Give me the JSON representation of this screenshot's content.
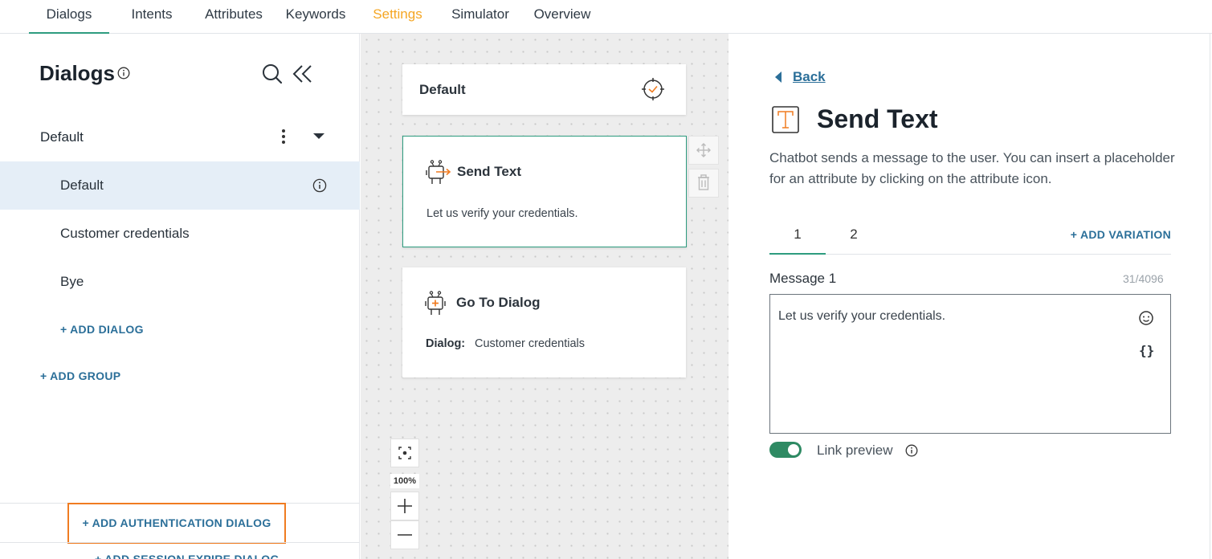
{
  "top_tabs": [
    {
      "label": "Dialogs"
    },
    {
      "label": "Intents"
    },
    {
      "label": "Attributes"
    },
    {
      "label": "Keywords"
    },
    {
      "label": "Settings"
    },
    {
      "label": "Simulator"
    },
    {
      "label": "Overview"
    }
  ],
  "sidebar": {
    "title": "Dialogs",
    "group": {
      "label": "Default"
    },
    "items": [
      {
        "label": "Default"
      },
      {
        "label": "Customer credentials"
      },
      {
        "label": "Bye"
      }
    ],
    "add_dialog": "+ ADD DIALOG",
    "add_group": "+ ADD GROUP",
    "add_auth_dialog": "+ ADD AUTHENTICATION DIALOG",
    "add_session_dialog": "+ ADD SESSION EXPIRE DIALOG"
  },
  "canvas": {
    "start_card": {
      "title": "Default"
    },
    "send_text_card": {
      "title": "Send Text",
      "text": "Let us verify your credentials."
    },
    "goto_card": {
      "title": "Go To Dialog",
      "dialog_label": "Dialog:",
      "dialog_value": "Customer credentials"
    },
    "zoom_level": "100%"
  },
  "panel": {
    "back": "Back",
    "title": "Send Text",
    "description": "Chatbot sends a message to the user. You can insert a placeholder for an attribute by clicking on the attribute icon.",
    "variation_tabs": [
      {
        "label": "1"
      },
      {
        "label": "2"
      }
    ],
    "add_variation": "+ ADD VARIATION",
    "message_label": "Message 1",
    "message_count": "31/4096",
    "message_text": "Let us verify your credentials.",
    "braces": "{}",
    "link_preview_label": "Link preview"
  },
  "colors": {
    "accent_green": "#2e9c7f",
    "link_blue": "#2b6f99",
    "settings_orange": "#f5a623",
    "highlight_orange": "#f07c21",
    "selected_bg": "#e5eef7"
  }
}
